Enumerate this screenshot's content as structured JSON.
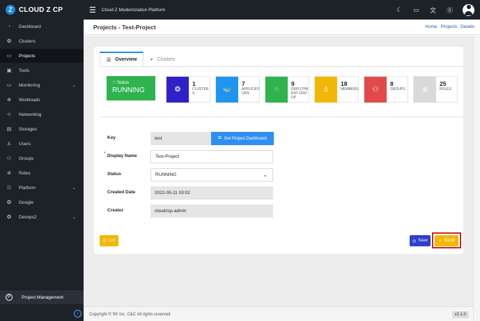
{
  "app": {
    "brand": "CLOUD Z CP",
    "logo_letter": "Z",
    "platform_title": "Cloud Z Modernization Platform"
  },
  "topbar_icons": [
    "moon-icon",
    "monitor-icon",
    "language-icon",
    "help-icon",
    "user-avatar-icon"
  ],
  "sidebar": {
    "items": [
      {
        "label": "Dashboard",
        "icon": "dashboard-icon",
        "glyph": "◔",
        "caret": ""
      },
      {
        "label": "Clusters",
        "icon": "clusters-icon",
        "glyph": "❂",
        "caret": ""
      },
      {
        "label": "Projects",
        "icon": "projects-icon",
        "glyph": "▭",
        "caret": "",
        "active": true
      },
      {
        "label": "Tools",
        "icon": "tools-icon",
        "glyph": "▣",
        "caret": ""
      },
      {
        "label": "Monitoring",
        "icon": "monitoring-icon",
        "glyph": "▭",
        "caret": "⌄"
      },
      {
        "label": "Workloads",
        "icon": "workloads-icon",
        "glyph": "⊕",
        "caret": ""
      },
      {
        "label": "Networking",
        "icon": "networking-icon",
        "glyph": "⊹",
        "caret": ""
      },
      {
        "label": "Storages",
        "icon": "storages-icon",
        "glyph": "▤",
        "caret": ""
      },
      {
        "label": "Users",
        "icon": "users-icon",
        "glyph": "♙",
        "caret": ""
      },
      {
        "label": "Groups",
        "icon": "groups-icon",
        "glyph": "⚇",
        "caret": ""
      },
      {
        "label": "Roles",
        "icon": "roles-icon",
        "glyph": "⊛",
        "caret": ""
      },
      {
        "label": "Platform",
        "icon": "platform-icon",
        "glyph": "☷",
        "caret": "⌄"
      },
      {
        "label": "Google",
        "icon": "google-icon",
        "glyph": "✪",
        "caret": ""
      },
      {
        "label": "Devops2",
        "icon": "devops-icon",
        "glyph": "✪",
        "caret": "⌄"
      }
    ],
    "bottom_label": "Project Management",
    "bottom_letter": "P"
  },
  "header": {
    "title": "Projects - Test-Project",
    "breadcrumbs": [
      "Home",
      "Projects",
      "Details"
    ]
  },
  "tabs": [
    {
      "label": "Overview",
      "icon": "list-icon",
      "glyph": "☰"
    },
    {
      "label": "Clusters",
      "icon": "cluster-tab-icon",
      "glyph": "●"
    }
  ],
  "status": {
    "label": "Status",
    "value": "RUNNING"
  },
  "stats": [
    {
      "number": "1",
      "label": "CLUSTERS",
      "color": "#2f21c9",
      "icon": "cluster-stat-icon",
      "glyph": "❂"
    },
    {
      "number": "7",
      "label": "APPLICATIONS",
      "color": "#1e96f0",
      "icon": "docker-icon",
      "glyph": "🐳"
    },
    {
      "number": "9",
      "label": "DEPLOYMENT GROUP",
      "color": "#2fb34f",
      "icon": "deployment-icon",
      "glyph": "⁘"
    },
    {
      "number": "18",
      "label": "MEMBERS",
      "color": "#f2b705",
      "icon": "members-icon",
      "glyph": "♙"
    },
    {
      "number": "8",
      "label": "GROUPS",
      "color": "#e04a4a",
      "icon": "groups-stat-icon",
      "glyph": "⚇"
    },
    {
      "number": "25",
      "label": "ROLES",
      "color": "#d9d9d9",
      "icon": "roles-stat-icon",
      "glyph": "⊛"
    }
  ],
  "form": {
    "key_label": "Key",
    "key_value": "test",
    "dashboard_button": "Get Project Dashboard",
    "display_name_label": "Display Name",
    "display_name_value": "Test-Project",
    "status_label": "Status",
    "status_value": "RUNNING",
    "created_label": "Created Date",
    "created_value": "2022-05-11 03:02",
    "creator_label": "Creator",
    "creator_value": "cloudzcp-admin"
  },
  "actions": {
    "list": "List",
    "save": "Save",
    "enroll": "Enroll"
  },
  "footer": {
    "copyright": "Copyright © SK Inc. C&C All rights reserved",
    "version": "v2.1.0"
  }
}
